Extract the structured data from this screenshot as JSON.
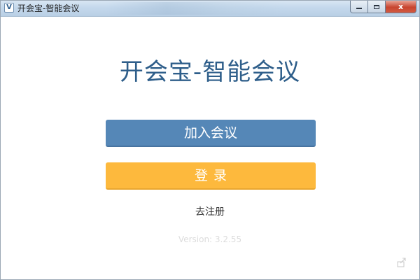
{
  "window": {
    "title": "开会宝-智能会议",
    "icon_letter": "V",
    "controls": {
      "minimize_icon": "minimize-icon",
      "maximize_icon": "maximize-icon",
      "close_label": "x"
    }
  },
  "main": {
    "app_title": "开会宝-智能会议",
    "join_button_label": "加入会议",
    "login_button_label": "登录",
    "register_link": "去注册",
    "version": "Version: 3.2.55"
  },
  "colors": {
    "title": "#2e5e8a",
    "join_button": "#5587b7",
    "login_button": "#fdb93d"
  },
  "icons": {
    "bottom_right": "export-icon"
  }
}
